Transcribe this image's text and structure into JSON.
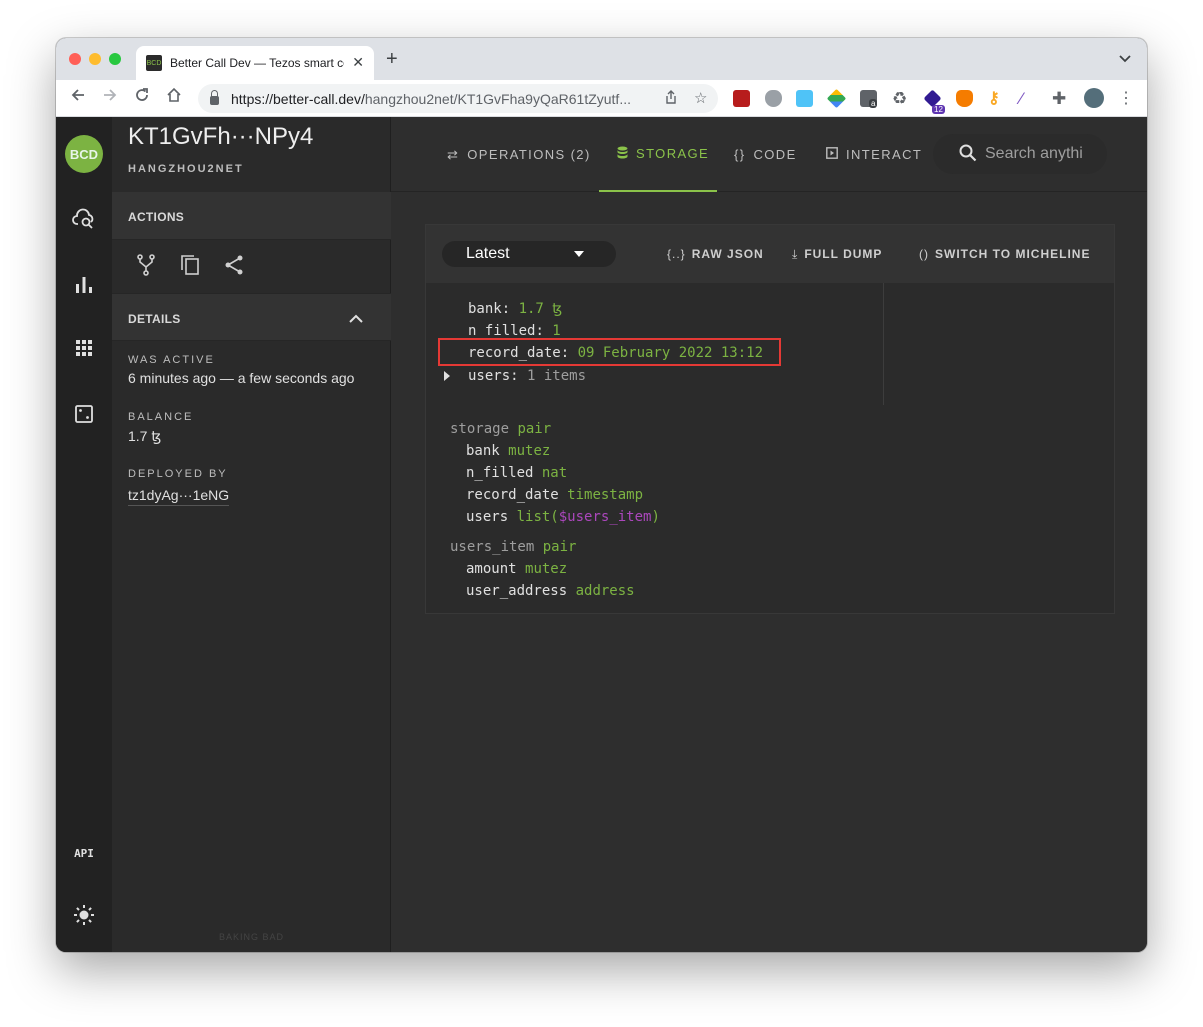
{
  "browser": {
    "tab_title": "Better Call Dev — Tezos smart contract explorer",
    "tab_favicon_text": "BCD",
    "url_host": "https://better-call.dev/",
    "url_path": "hangzhou2net/KT1GvFha9yQaR61tZyutf..."
  },
  "sidebar": {
    "logo": "BCD",
    "contract_title": "KT1GvFh···NPy4",
    "network": "HANGZHOU2NET",
    "actions_label": "ACTIONS",
    "details_label": "DETAILS",
    "was_active_label": "WAS ACTIVE",
    "was_active_value": "6 minutes ago — a few seconds ago",
    "balance_label": "BALANCE",
    "balance_value": "1.7 ꜩ",
    "deployed_by_label": "DEPLOYED BY",
    "deployed_by_value": "tz1dyAg···1eNG",
    "footer": "BAKING BAD",
    "api_label": "API"
  },
  "nav": {
    "tabs": [
      {
        "label": "OPERATIONS (2)",
        "icon": "arrows-icon"
      },
      {
        "label": "STORAGE",
        "icon": "database-icon"
      },
      {
        "label": "CODE",
        "icon": "braces-icon"
      },
      {
        "label": "INTERACT",
        "icon": "play-box-icon"
      }
    ],
    "active_tab": "STORAGE",
    "search_placeholder": "Search anythi"
  },
  "storage": {
    "selector": "Latest",
    "buttons": {
      "raw_json": "RAW JSON",
      "full_dump": "FULL DUMP",
      "switch": "SWITCH TO MICHELINE"
    },
    "icons": {
      "raw_json": "{..}",
      "full_dump": "⤓",
      "switch": "()"
    },
    "fields": [
      {
        "key": "bank",
        "value": "1.7 ꜩ"
      },
      {
        "key": "n_filled",
        "value": "1"
      },
      {
        "key": "record_date",
        "value": "09 February 2022 13:12"
      },
      {
        "key": "users",
        "value": "1 items"
      }
    ],
    "schema": [
      {
        "indent": 0,
        "name": "storage",
        "type": "pair"
      },
      {
        "indent": 1,
        "name": "bank",
        "type": "mutez"
      },
      {
        "indent": 1,
        "name": "n_filled",
        "type": "nat"
      },
      {
        "indent": 1,
        "name": "record_date",
        "type": "timestamp"
      },
      {
        "indent": 1,
        "name": "users",
        "type": "list(",
        "var": "$users_item",
        "close": ")"
      },
      {
        "indent": 0,
        "name": "users_item",
        "type": "pair"
      },
      {
        "indent": 1,
        "name": "amount",
        "type": "mutez"
      },
      {
        "indent": 1,
        "name": "user_address",
        "type": "address"
      }
    ]
  },
  "colors": {
    "accent_green": "#8bc34a",
    "highlight_red": "#e53935",
    "schema_var": "#ab47bc"
  }
}
